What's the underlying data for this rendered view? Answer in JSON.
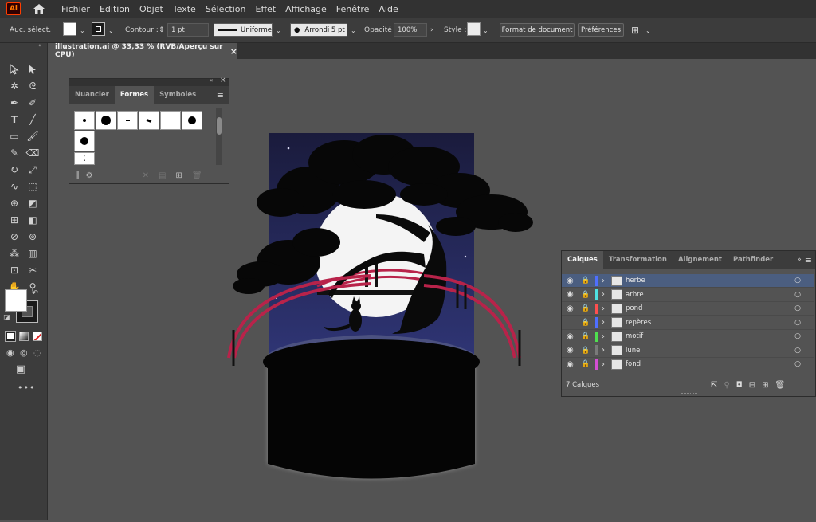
{
  "app": {
    "logo": "Ai"
  },
  "menu": [
    "Fichier",
    "Edition",
    "Objet",
    "Texte",
    "Sélection",
    "Effet",
    "Affichage",
    "Fenêtre",
    "Aide"
  ],
  "control": {
    "selection_label": "Auc. sélect.",
    "stroke_label": "Contour :",
    "stroke_value": "1 pt",
    "profile": "Uniforme",
    "brush": "Arrondi 5 pt",
    "opacity_label": "Opacité :",
    "opacity_value": "100%",
    "style_label": "Style :",
    "doc_format": "Format de document",
    "prefs": "Préférences"
  },
  "document": {
    "tab_title": "illustration.ai @ 33,33 % (RVB/Aperçu sur CPU)",
    "close": "×"
  },
  "shapes_panel": {
    "tabs": [
      "Nuancier",
      "Formes",
      "Symboles"
    ],
    "active_tab": "Formes"
  },
  "layers_panel": {
    "tabs": [
      "Calques",
      "Transformation",
      "Alignement",
      "Pathfinder"
    ],
    "active_tab": "Calques",
    "count_text": "7 Calques",
    "layers": [
      {
        "name": "herbe",
        "color": "#4f6fff",
        "visible": true,
        "selected": true
      },
      {
        "name": "arbre",
        "color": "#4fe0e0",
        "visible": true,
        "selected": false
      },
      {
        "name": "pond",
        "color": "#ff4f4f",
        "visible": true,
        "selected": false
      },
      {
        "name": "repères",
        "color": "#4f6fff",
        "visible": false,
        "selected": false
      },
      {
        "name": "motif",
        "color": "#4fdf4f",
        "visible": true,
        "selected": false
      },
      {
        "name": "lune",
        "color": "#7a7a7a",
        "visible": true,
        "selected": false
      },
      {
        "name": "fond",
        "color": "#d44fd4",
        "visible": true,
        "selected": false
      }
    ]
  },
  "colors": {
    "accent": "#4b5e80",
    "bridge": "#b8234a",
    "sky": "#26295a",
    "moon": "#f4f4f4"
  }
}
